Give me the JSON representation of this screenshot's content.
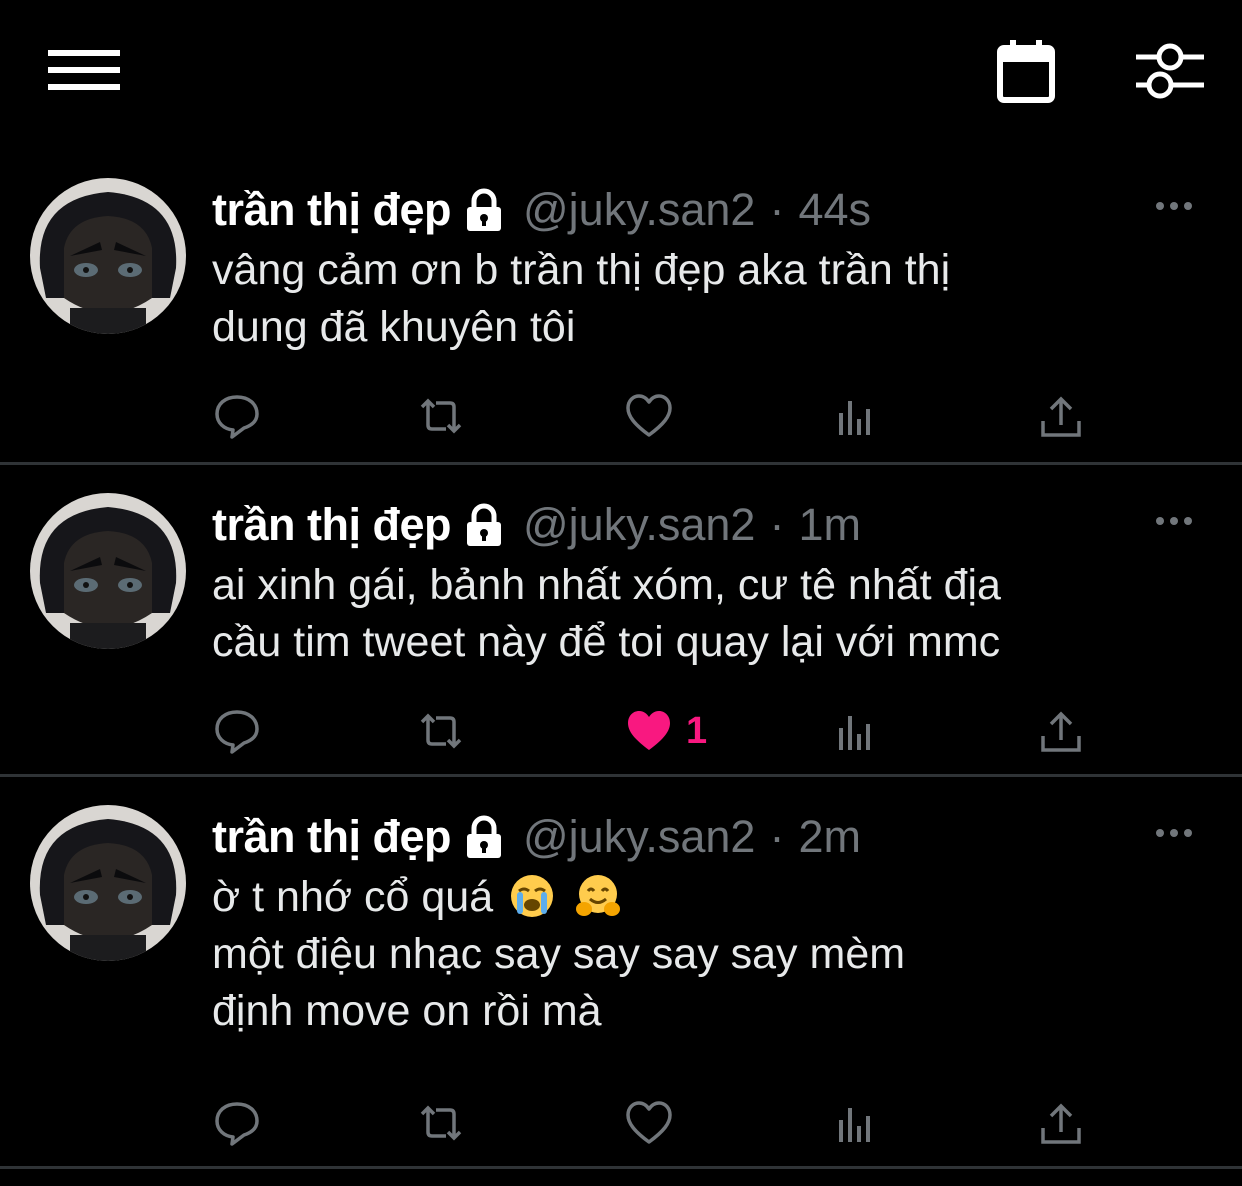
{
  "topbar": {
    "menu_icon": "hamburger-menu-icon",
    "calendar_icon": "calendar-icon",
    "filter_icon": "sliders-icon"
  },
  "colors": {
    "background": "#000000",
    "text": "#e7e9ea",
    "muted": "#71767b",
    "divider": "#2f3336",
    "like_active": "#f91880"
  },
  "tweets": [
    {
      "name": "trần thị đẹp",
      "handle": "@juky.san2",
      "separator": "·",
      "time": "44s",
      "text": "vâng cảm ơn b trần thị đẹp aka trần thị\ndung đã khuyên tôi",
      "liked": false,
      "like_count": ""
    },
    {
      "name": "trần thị đẹp",
      "handle": "@juky.san2",
      "separator": "·",
      "time": "1m",
      "text": "ai xinh gái, bảnh nhất xóm, cư tê nhất địa\ncầu tim tweet này để toi quay lại với mmc",
      "liked": true,
      "like_count": "1"
    },
    {
      "name": "trần thị đẹp",
      "handle": "@juky.san2",
      "separator": "·",
      "time": "2m",
      "text_line1": "ờ t nhớ cổ quá",
      "emojis": [
        "loudly-crying-face",
        "hugging-face"
      ],
      "text_rest": "một điệu nhạc say say say say mèm\nđịnh move on rồi mà",
      "liked": false,
      "like_count": ""
    }
  ]
}
